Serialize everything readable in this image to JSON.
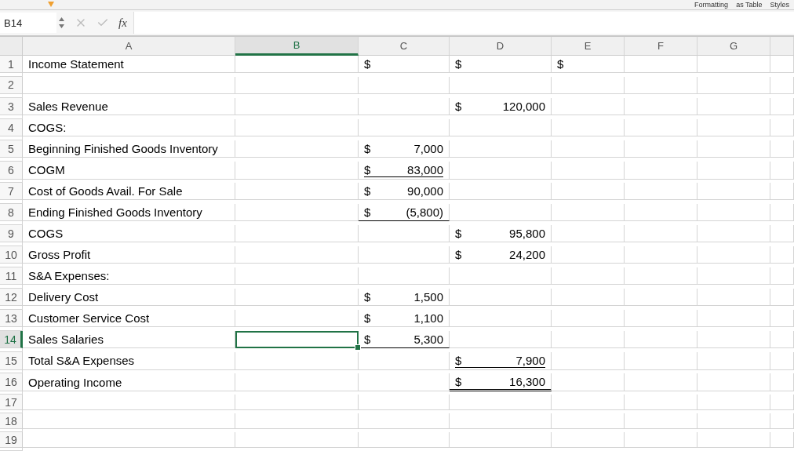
{
  "ribbon": {
    "labels": [
      "Formatting",
      "as Table",
      "Styles"
    ]
  },
  "formula_bar": {
    "name_box": "B14",
    "function_label": "fx"
  },
  "columns": [
    {
      "label": "A",
      "selected": false
    },
    {
      "label": "B",
      "selected": true
    },
    {
      "label": "C",
      "selected": false
    },
    {
      "label": "D",
      "selected": false
    },
    {
      "label": "E",
      "selected": false
    },
    {
      "label": "F",
      "selected": false
    },
    {
      "label": "G",
      "selected": false
    }
  ],
  "rows": [
    {
      "number": "1",
      "selected": false,
      "a": "Income Statement",
      "c": {
        "symbol": "$"
      },
      "d": {
        "symbol": "$"
      },
      "e": {
        "symbol": "$"
      }
    },
    {
      "number": "2",
      "selected": false
    },
    {
      "number": "3",
      "selected": false,
      "a": "Sales Revenue",
      "d": {
        "symbol": "$",
        "value": "120,000"
      }
    },
    {
      "number": "4",
      "selected": false,
      "a": "COGS:"
    },
    {
      "number": "5",
      "selected": false,
      "a": "Beginning Finished Goods Inventory",
      "c": {
        "symbol": "$",
        "value": "7,000"
      }
    },
    {
      "number": "6",
      "selected": false,
      "a": "COGM",
      "c": {
        "symbol": "$",
        "value": "83,000",
        "underline": true
      }
    },
    {
      "number": "7",
      "selected": false,
      "a": "Cost of Goods Avail. For Sale",
      "c": {
        "symbol": "$",
        "value": "90,000"
      }
    },
    {
      "number": "8",
      "selected": false,
      "a": "Ending Finished Goods Inventory",
      "c": {
        "symbol": "$",
        "value": "(5,800)",
        "bottom_rule": true
      }
    },
    {
      "number": "9",
      "selected": false,
      "a": "COGS",
      "d": {
        "symbol": "$",
        "value": "95,800"
      }
    },
    {
      "number": "10",
      "selected": false,
      "a": "Gross Profit",
      "d": {
        "symbol": "$",
        "value": "24,200"
      }
    },
    {
      "number": "11",
      "selected": false,
      "a": "S&A Expenses:"
    },
    {
      "number": "12",
      "selected": false,
      "a": "Delivery Cost",
      "c": {
        "symbol": "$",
        "value": "1,500"
      }
    },
    {
      "number": "13",
      "selected": false,
      "a": "Customer Service Cost",
      "c": {
        "symbol": "$",
        "value": "1,100"
      }
    },
    {
      "number": "14",
      "selected": true,
      "a": "Sales Salaries",
      "c": {
        "symbol": "$",
        "value": "5,300",
        "bottom_rule": true
      }
    },
    {
      "number": "15",
      "selected": false,
      "a": "Total S&A Expenses",
      "d": {
        "symbol": "$",
        "value": "7,900",
        "underline": true
      }
    },
    {
      "number": "16",
      "selected": false,
      "a": "Operating Income",
      "d": {
        "symbol": "$",
        "value": "16,300",
        "double_rule": true
      }
    },
    {
      "number": "17",
      "selected": false
    },
    {
      "number": "18",
      "selected": false
    },
    {
      "number": "19",
      "selected": false
    }
  ]
}
